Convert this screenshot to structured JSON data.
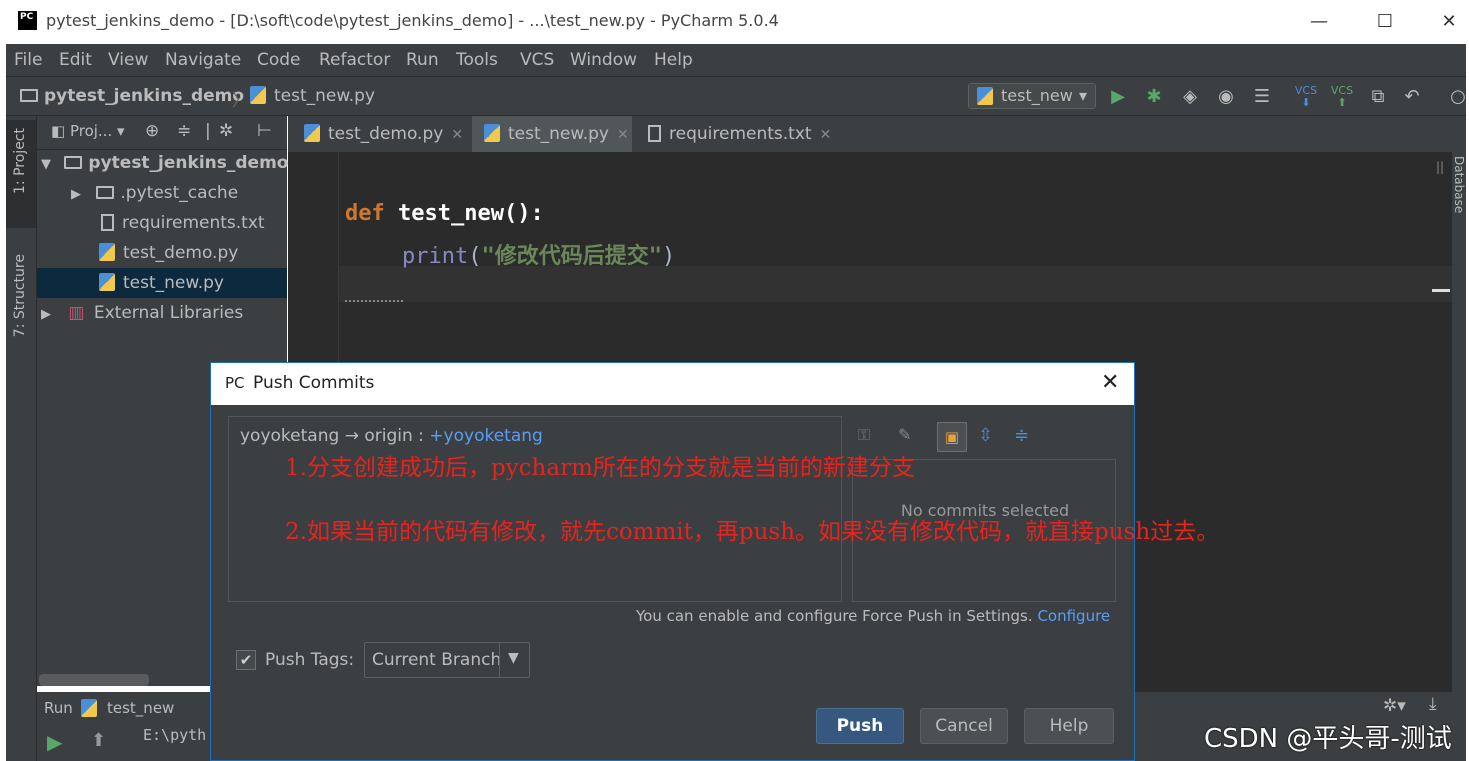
{
  "window": {
    "title": "pytest_jenkins_demo - [D:\\soft\\code\\pytest_jenkins_demo] - ...\\test_new.py - PyCharm 5.0.4",
    "app_icon": "pycharm-logo",
    "minimize": "—",
    "maximize": "☐",
    "close": "✕"
  },
  "menu": [
    "File",
    "Edit",
    "View",
    "Navigate",
    "Code",
    "Refactor",
    "Run",
    "Tools",
    "VCS",
    "Window",
    "Help"
  ],
  "breadcrumb": {
    "project": "pytest_jenkins_demo",
    "file": "test_new.py"
  },
  "run_config": {
    "label": "test_new",
    "arrow": "▾"
  },
  "left_strip": {
    "project_tab": "1: Project",
    "structure_tab": "7: Structure"
  },
  "right_strip": {
    "database_tab": "Database"
  },
  "project_panel": {
    "header_label": "Proj...",
    "tree": [
      {
        "label": "pytest_jenkins_demo",
        "type": "folder",
        "expanded": true
      },
      {
        "label": ".pytest_cache",
        "type": "folder",
        "expanded": false
      },
      {
        "label": "requirements.txt",
        "type": "text"
      },
      {
        "label": "test_demo.py",
        "type": "python"
      },
      {
        "label": "test_new.py",
        "type": "python",
        "selected": true
      },
      {
        "label": "External Libraries",
        "type": "library"
      }
    ]
  },
  "tabs": [
    {
      "label": "test_demo.py",
      "active": false
    },
    {
      "label": "test_new.py",
      "active": true
    },
    {
      "label": "requirements.txt",
      "active": false
    }
  ],
  "editor": {
    "keyword": "def",
    "func": "test_new",
    "parens": "():",
    "print_fn": "print",
    "open": "(",
    "string": "\"修改代码后提交\"",
    "close": ")",
    "colors": {
      "keyword": "#cc7832",
      "func": "#ffffff",
      "string": "#6a8759",
      "builtin": "#8888c6",
      "text": "#a9b7c6"
    }
  },
  "run_panel": {
    "label": "Run",
    "config": "test_new",
    "console": "E:\\pyth"
  },
  "dialog": {
    "title": "Push Commits",
    "branch_local": "yoyoketang",
    "arrow": "→",
    "remote": "origin :",
    "branch_remote": "+yoyoketang",
    "no_commits": "No commits selected",
    "force_push_text": "You can enable and configure Force Push in Settings.",
    "configure_link": "Configure",
    "push_tags_label": "Push Tags:",
    "push_tags_checked": true,
    "push_tags_option": "Current Branch",
    "buttons": {
      "push": "Push",
      "cancel": "Cancel",
      "help": "Help"
    },
    "link_color": "#589df6"
  },
  "annotations": {
    "line1": "1.分支创建成功后，pycharm所在的分支就是当前的新建分支",
    "line2": "2.如果当前的代码有修改，就先commit，再push。如果没有修改代码，就直接push过去。"
  },
  "watermark": "CSDN @平头哥-测试"
}
